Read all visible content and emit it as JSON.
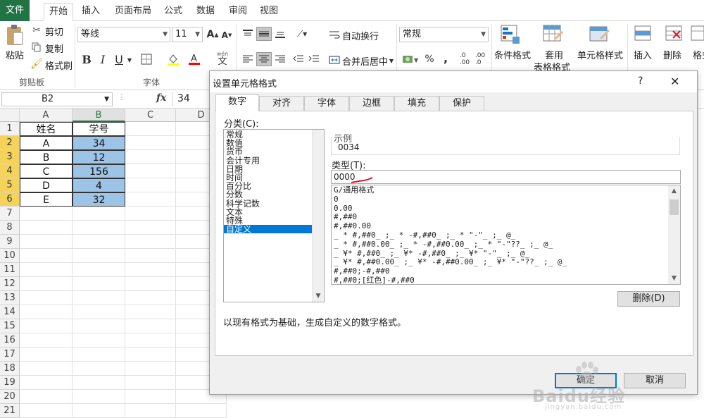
{
  "menu": {
    "tabs": [
      "文件",
      "开始",
      "插入",
      "页面布局",
      "公式",
      "数据",
      "审阅",
      "视图"
    ],
    "active": "开始"
  },
  "ribbon": {
    "clipboard": {
      "paste": "粘贴",
      "cut": "剪切",
      "copy": "复制",
      "format_painter": "格式刷",
      "group_label": "剪贴板"
    },
    "font": {
      "font_name": "等线",
      "font_size": "11",
      "bold": "B",
      "italic": "I",
      "underline": "U",
      "group_label": "字体",
      "wen": "wén",
      "wen_char": "文"
    },
    "alignment": {
      "wrap_text": "自动换行",
      "merge_center": "合并后居中"
    },
    "number": {
      "format": "常规",
      "percent": "%",
      "comma": ","
    },
    "styles": {
      "conditional_format": "条件格式",
      "table_format_line1": "套用",
      "table_format_line2": "表格格式",
      "cell_styles": "单元格样式"
    },
    "cells": {
      "insert": "插入",
      "delete": "删除",
      "format": "格式"
    }
  },
  "formula_bar": {
    "name_box": "B2",
    "fx": "fx",
    "value": "34"
  },
  "sheet": {
    "columns": [
      "A",
      "B",
      "C",
      "D"
    ],
    "rows": [
      "1",
      "2",
      "3",
      "4",
      "5",
      "6",
      "7",
      "8",
      "9",
      "10",
      "11",
      "12",
      "13",
      "14",
      "15",
      "16",
      "17",
      "18",
      "19",
      "20",
      "21"
    ],
    "header_row": [
      "姓名",
      "学号"
    ],
    "data": [
      [
        "A",
        "34"
      ],
      [
        "B",
        "12"
      ],
      [
        "C",
        "156"
      ],
      [
        "D",
        "4"
      ],
      [
        "E",
        "32"
      ]
    ]
  },
  "dialog": {
    "title": "设置单元格格式",
    "help": "?",
    "close": "✕",
    "tabs": [
      "数字",
      "对齐",
      "字体",
      "边框",
      "填充",
      "保护"
    ],
    "active_tab": "数字",
    "category_label": "分类(C):",
    "categories": [
      "常规",
      "数值",
      "货币",
      "会计专用",
      "日期",
      "时间",
      "百分比",
      "分数",
      "科学记数",
      "文本",
      "特殊",
      "自定义"
    ],
    "selected_category": "自定义",
    "sample_label": "示例",
    "sample_value": "0034",
    "type_label": "类型(T):",
    "type_value": "0000",
    "format_list": [
      "G/通用格式",
      "0",
      "0.00",
      "#,##0",
      "#,##0.00",
      "_ * #,##0_ ;_ * -#,##0_ ;_ * \"-\"_ ;_ @_",
      "_ * #,##0.00_ ;_ * -#,##0.00_ ;_ * \"-\"??_ ;_ @_",
      "_ ¥* #,##0_ ;_ ¥* -#,##0_ ;_ ¥* \"-\"_ ;_ @_",
      "_ ¥* #,##0.00_ ;_ ¥* -#,##0.00_ ;_ ¥* \"-\"??_ ;_ @_",
      "#,##0;-#,##0",
      "#,##0;[红色]-#,##0"
    ],
    "delete_button": "删除(D)",
    "description": "以现有格式为基础，生成自定义的数字格式。",
    "ok_button": "确定",
    "cancel_button": "取消"
  },
  "watermark": {
    "brand": "Baidu经验",
    "url": "jingyan.baidu.com"
  },
  "colors": {
    "accent": "#217346",
    "selection": "#9dc3e6",
    "row_header_selected": "#f5d35a",
    "list_selection": "#0078d7",
    "annotation_red": "#e0142c"
  }
}
